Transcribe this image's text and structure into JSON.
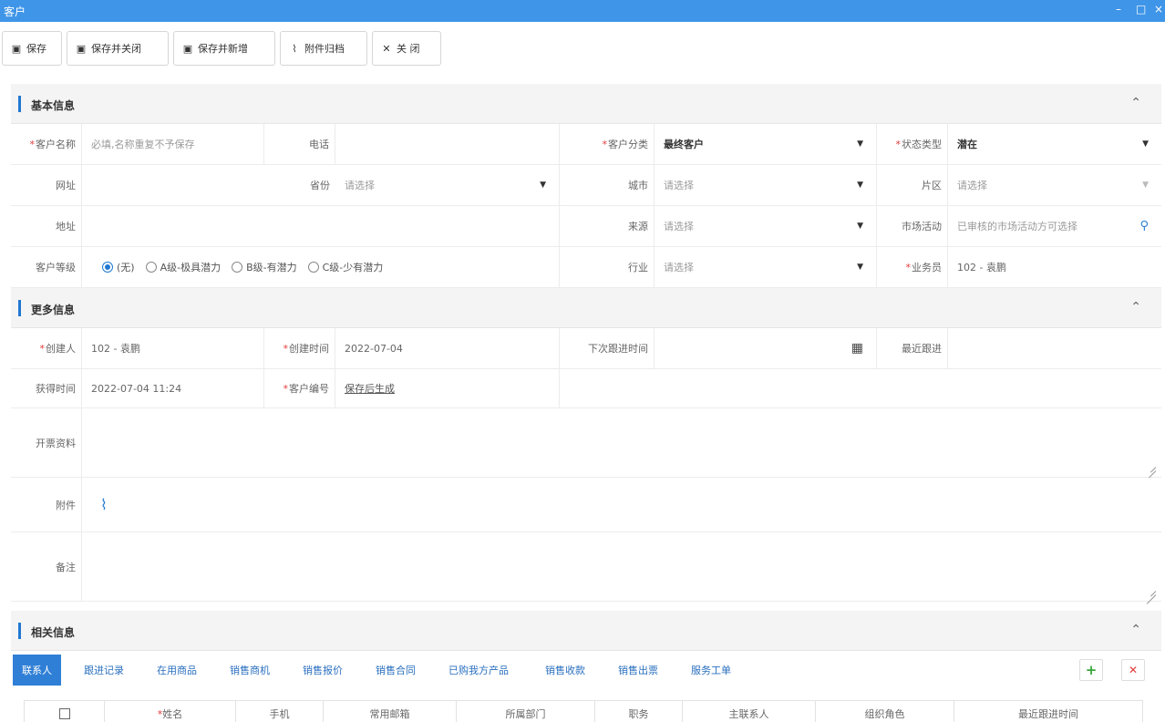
{
  "window": {
    "title": "客户",
    "minimize": "–",
    "maximize": "□",
    "close": "×"
  },
  "toolbar": {
    "save": "保存",
    "save_close": "保存并关闭",
    "save_new": "保存并新增",
    "attach_archive": "附件归档",
    "close": "关 闭"
  },
  "basic": {
    "title": "基本信息",
    "name_label": "客户名称",
    "name_placeholder": "必填,名称重复不予保存",
    "phone_label": "电话",
    "category_label": "客户分类",
    "category_value": "最终客户",
    "status_label": "状态类型",
    "status_value": "潜在",
    "website_label": "网址",
    "province_label": "省份",
    "province_placeholder": "请选择",
    "city_label": "城市",
    "city_placeholder": "请选择",
    "district_label": "片区",
    "district_placeholder": "请选择",
    "address_label": "地址",
    "source_label": "来源",
    "source_placeholder": "请选择",
    "campaign_label": "市场活动",
    "campaign_placeholder": "已审核的市场活动方可选择",
    "grade_label": "客户等级",
    "grade_options": [
      "(无)",
      "A级-极具潜力",
      "B级-有潜力",
      "C级-少有潜力"
    ],
    "industry_label": "行业",
    "industry_placeholder": "请选择",
    "salesman_label": "业务员",
    "salesman_value": "102 - 袁鹏"
  },
  "more": {
    "title": "更多信息",
    "creator_label": "创建人",
    "creator_value": "102 - 袁鹏",
    "created_label": "创建时间",
    "created_value": "2022-07-04",
    "next_followup_label": "下次跟进时间",
    "last_followup_label": "最近跟进",
    "acquired_label": "获得时间",
    "acquired_value": "2022-07-04 11:24",
    "customer_no_label": "客户编号",
    "customer_no_value": "保存后生成",
    "invoice_label": "开票资料",
    "attachment_label": "附件",
    "remark_label": "备注"
  },
  "related": {
    "title": "相关信息",
    "tabs": [
      "联系人",
      "跟进记录",
      "在用商品",
      "销售商机",
      "销售报价",
      "销售合同",
      "已购我方产品",
      "销售收款",
      "销售出票",
      "服务工单"
    ],
    "add": "+",
    "remove": "✕",
    "columns": [
      "姓名",
      "手机",
      "常用邮箱",
      "所属部门",
      "职务",
      "主联系人",
      "组织角色",
      "最近跟进时间"
    ]
  }
}
